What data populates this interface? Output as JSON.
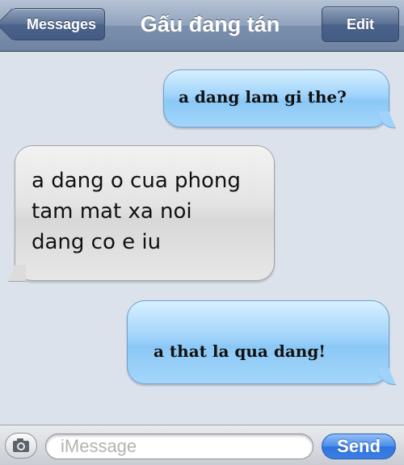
{
  "navbar": {
    "back_label": "Messages",
    "title": "Gấu đang tán",
    "edit_label": "Edit"
  },
  "messages": [
    {
      "direction": "sent",
      "text": "a dang lam gi the?"
    },
    {
      "direction": "received",
      "text": "a dang o cua phong\ntam mat xa noi\ndang co e iu"
    },
    {
      "direction": "sent",
      "text": "a that la qua dang!"
    }
  ],
  "composer": {
    "placeholder": "iMessage",
    "send_label": "Send",
    "camera_icon": "camera-icon"
  },
  "colors": {
    "sent_bubble": "#9fd3fb",
    "received_bubble": "#dcdcdc",
    "send_button": "#3a7fe4",
    "background": "#dbe2ec"
  }
}
